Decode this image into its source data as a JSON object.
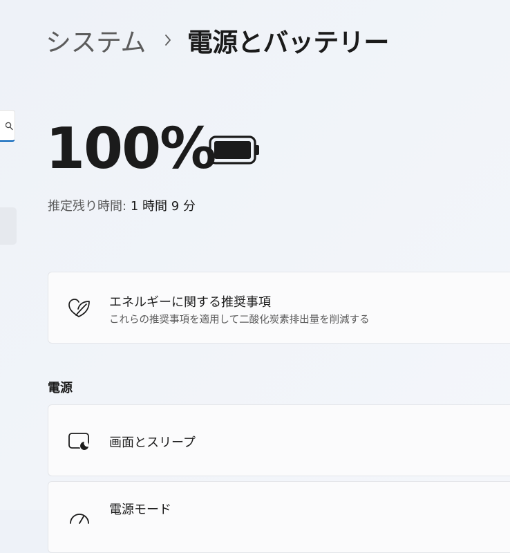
{
  "breadcrumb": {
    "parent": "システム",
    "current": "電源とバッテリー"
  },
  "battery": {
    "percent": "100%",
    "remaining_label": "推定残り時間:",
    "remaining_value": "1 時間 9 分",
    "level": 1.0
  },
  "energy_card": {
    "title": "エネルギーに関する推奨事項",
    "subtitle": "これらの推奨事項を適用して二酸化炭素排出量を削減する",
    "icon": "leaf-heart-icon"
  },
  "power_section": {
    "header": "電源",
    "items": [
      {
        "title": "画面とスリープ",
        "icon": "screen-sleep-icon"
      },
      {
        "title": "電源モード",
        "icon": "power-mode-icon"
      }
    ]
  },
  "colors": {
    "accent": "#005fb8",
    "background": "#eff3f9"
  }
}
